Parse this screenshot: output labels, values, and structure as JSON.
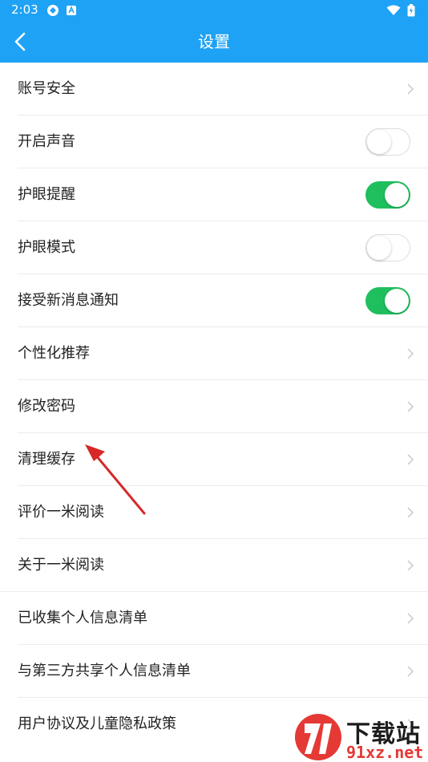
{
  "status_bar": {
    "time": "2:03"
  },
  "header": {
    "title": "设置"
  },
  "settings": [
    {
      "label": "账号安全",
      "type": "link"
    },
    {
      "label": "开启声音",
      "type": "toggle",
      "on": false
    },
    {
      "label": "护眼提醒",
      "type": "toggle",
      "on": true
    },
    {
      "label": "护眼模式",
      "type": "toggle",
      "on": false
    },
    {
      "label": "接受新消息通知",
      "type": "toggle",
      "on": true
    },
    {
      "label": "个性化推荐",
      "type": "link"
    },
    {
      "label": "修改密码",
      "type": "link"
    },
    {
      "label": "清理缓存",
      "type": "link"
    },
    {
      "label": "评价一米阅读",
      "type": "link"
    },
    {
      "label": "关于一米阅读",
      "type": "link"
    },
    {
      "label": "已收集个人信息清单",
      "type": "link"
    },
    {
      "label": "与第三方共享个人信息清单",
      "type": "link"
    },
    {
      "label": "用户协议及儿童隐私政策",
      "type": "link"
    }
  ],
  "watermark": {
    "title": "下载站",
    "domain": "91xz.net"
  },
  "colors": {
    "header": "#1ea2f5",
    "toggle_on": "#1fbf5e",
    "annotation_arrow": "#d62828",
    "watermark_red": "#e53935"
  },
  "icons": [
    "back-arrow-icon",
    "chevron-right-icon",
    "wifi-icon",
    "battery-icon",
    "notification-icon"
  ]
}
